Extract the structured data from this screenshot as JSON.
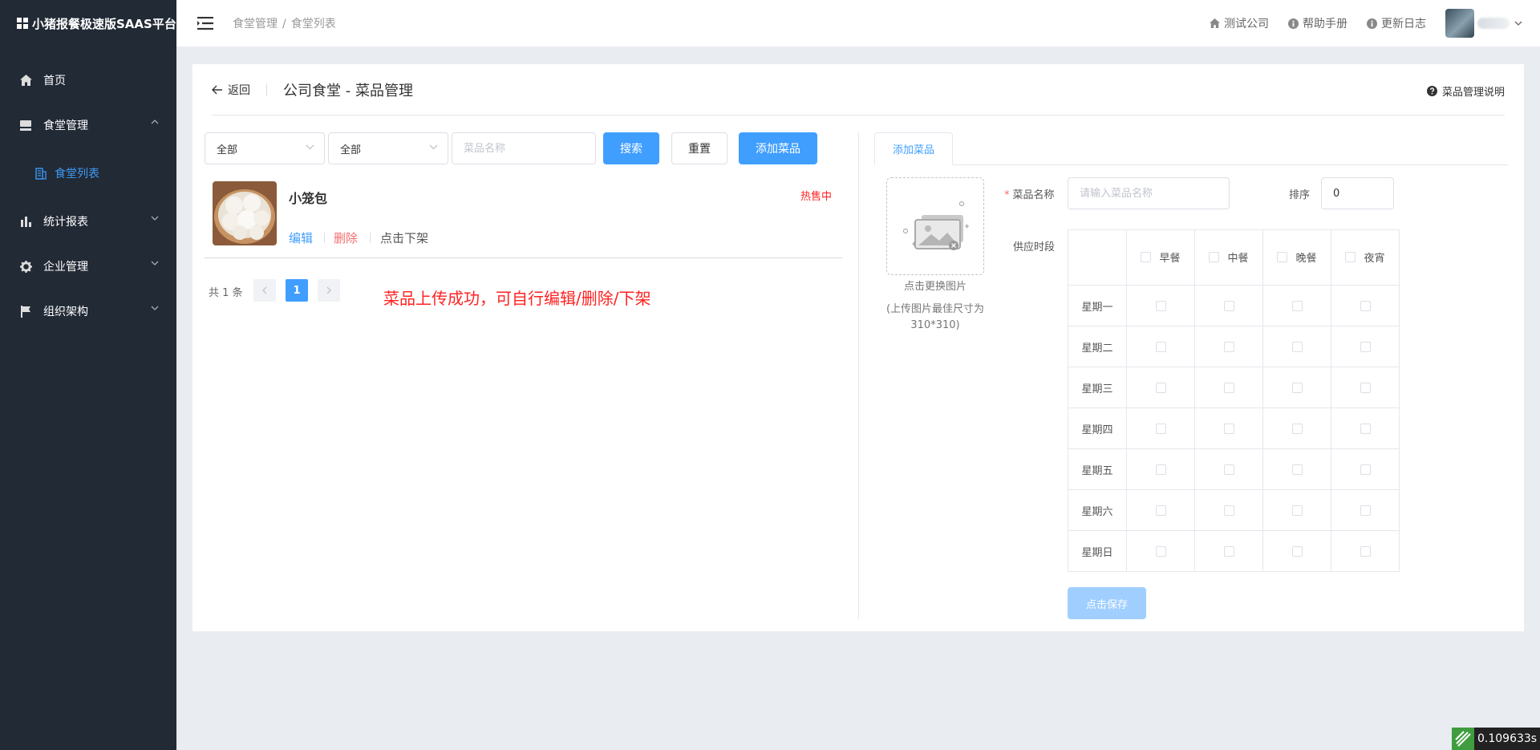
{
  "app": {
    "title": "小猪报餐极速版SAAS平台"
  },
  "sidebar": {
    "items": [
      {
        "label": "首页",
        "icon": "home-icon"
      },
      {
        "label": "食堂管理",
        "icon": "canteen-icon",
        "expanded": true
      },
      {
        "label": "食堂列表",
        "icon": "list-icon",
        "active": true
      },
      {
        "label": "统计报表",
        "icon": "bar-chart-icon"
      },
      {
        "label": "企业管理",
        "icon": "gear-icon"
      },
      {
        "label": "组织架构",
        "icon": "flag-icon"
      }
    ]
  },
  "header": {
    "breadcrumb": [
      "食堂管理",
      "食堂列表"
    ],
    "breadcrumb_sep": "/",
    "links": [
      {
        "label": "测试公司",
        "icon": "home-icon"
      },
      {
        "label": "帮助手册",
        "icon": "info-icon"
      },
      {
        "label": "更新日志",
        "icon": "info-icon"
      }
    ]
  },
  "page": {
    "back_label": "返回",
    "title": "公司食堂 - 菜品管理",
    "help_label": "菜品管理说明"
  },
  "filters": {
    "select1": "全部",
    "select2": "全部",
    "search_placeholder": "菜品名称",
    "search_label": "搜索",
    "reset_label": "重置",
    "add_label": "添加菜品"
  },
  "dish": {
    "name": "小笼包",
    "status": "热售中",
    "edit_label": "编辑",
    "delete_label": "删除",
    "offline_label": "点击下架"
  },
  "pagination": {
    "total_text": "共 1 条",
    "current_page": "1"
  },
  "annotation": "菜品上传成功，可自行编辑/删除/下架",
  "form": {
    "tab_label": "添加菜品",
    "upload_caption": "点击更换图片",
    "upload_hint": "(上传图片最佳尺寸为310*310)",
    "name_label": "菜品名称",
    "name_placeholder": "请输入菜品名称",
    "sort_label": "排序",
    "sort_value": "0",
    "period_label": "供应时段",
    "meals": [
      "早餐",
      "中餐",
      "晚餐",
      "夜宵"
    ],
    "days": [
      "星期一",
      "星期二",
      "星期三",
      "星期四",
      "星期五",
      "星期六",
      "星期日"
    ],
    "save_label": "点击保存"
  },
  "timer": {
    "value": "0.109633s"
  },
  "colors": {
    "primary": "#409eff",
    "danger": "#f56c6c",
    "sidebar": "#222a36",
    "annotation": "#ff2222"
  }
}
